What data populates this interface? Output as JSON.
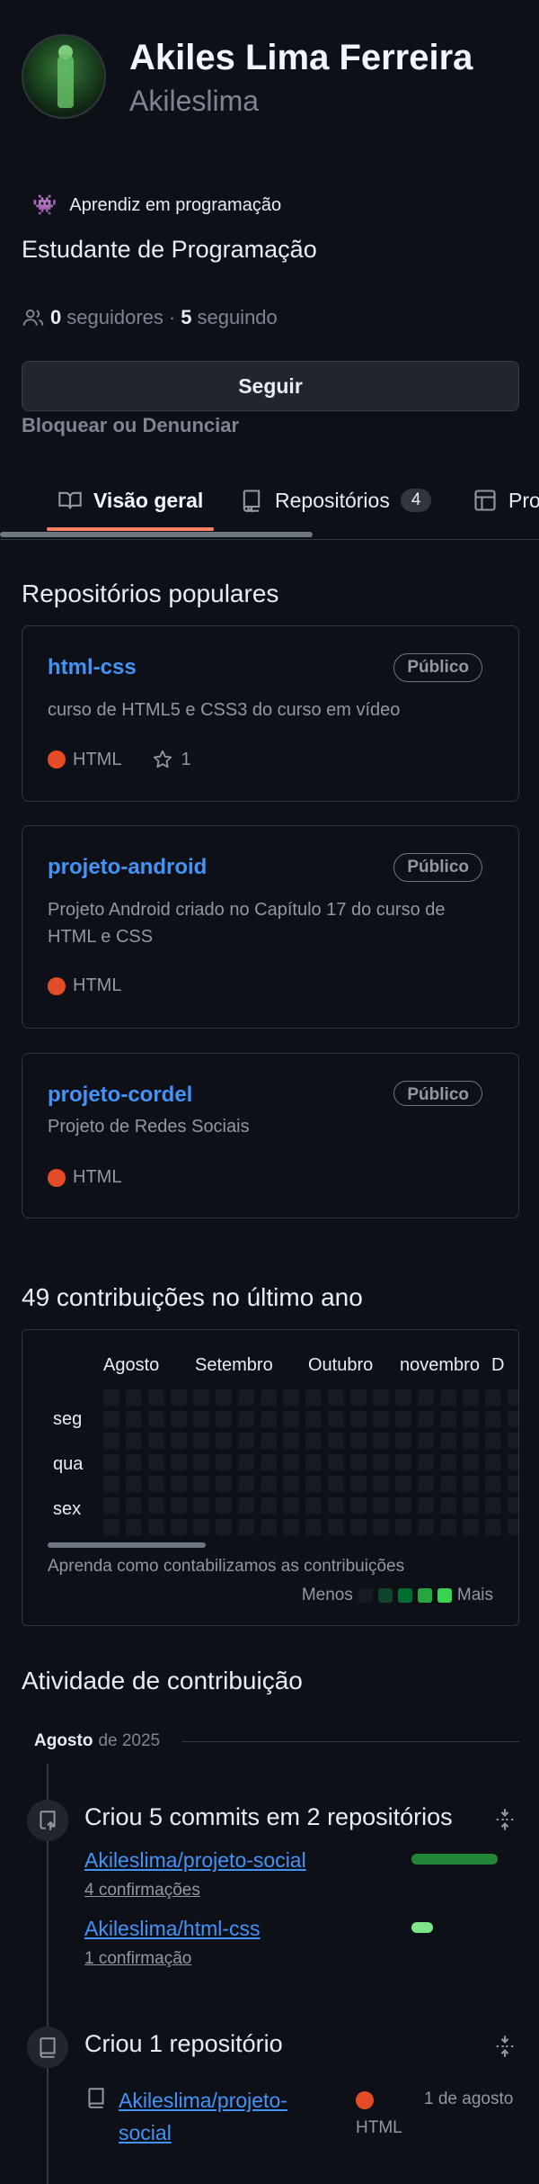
{
  "profile": {
    "name": "Akiles Lima Ferreira",
    "login": "Akileslima",
    "status_emoji": "👾",
    "status_text": "Aprendiz em programação",
    "bio": "Estudante de Programação",
    "followers_count": "0",
    "followers_label": "seguidores",
    "separator": "·",
    "following_count": "5",
    "following_label": "seguindo",
    "follow_button": "Seguir",
    "block_link": "Bloquear ou Denunciar"
  },
  "tabs": [
    {
      "label": "Visão geral",
      "icon": "book-icon",
      "active": true
    },
    {
      "label": "Repositórios",
      "icon": "repo-icon",
      "counter": "4"
    },
    {
      "label": "Projetos",
      "icon": "project-icon"
    }
  ],
  "popular": {
    "title": "Repositórios populares",
    "repos": [
      {
        "name": "html-css",
        "visibility": "Público",
        "description": "curso de HTML5 e CSS3 do curso em vídeo",
        "language": "HTML",
        "stars": "1"
      },
      {
        "name": "projeto-android",
        "visibility": "Público",
        "description": "Projeto Android criado no Capítulo 17 do curso de HTML e CSS",
        "language": "HTML"
      },
      {
        "name": "projeto-cordel",
        "visibility": "Público",
        "description": "Projeto de Redes Sociais",
        "language": "HTML"
      }
    ]
  },
  "contributions": {
    "title": "49 contribuições no último ano",
    "months": [
      "Agosto",
      "Setembro",
      "Outubro",
      "novembro",
      "D"
    ],
    "days": [
      "seg",
      "qua",
      "sex"
    ],
    "learn_text": "Aprenda como contabilizamos as contribuições",
    "legend_less": "Menos",
    "legend_more": "Mais",
    "legend_colors": [
      "#161b22",
      "#0e4429",
      "#006d32",
      "#26a641",
      "#39d353"
    ]
  },
  "activity": {
    "title": "Atividade de contribuição",
    "month": "Agosto",
    "year": "de 2025",
    "events": [
      {
        "title": "Criou 5 commits em 2 repositórios",
        "items": [
          {
            "repo": "Akileslima/projeto-social",
            "sub": "4 confirmações",
            "bar_fraction": 0.8
          },
          {
            "repo": "Akileslima/html-css",
            "sub": "1 confirmação",
            "bar_fraction": 0.2
          }
        ]
      },
      {
        "title": "Criou 1 repositório",
        "repo_line1": "Akileslima/projeto-",
        "repo_line2": "social",
        "language": "HTML",
        "date": "1 de agosto"
      }
    ]
  }
}
